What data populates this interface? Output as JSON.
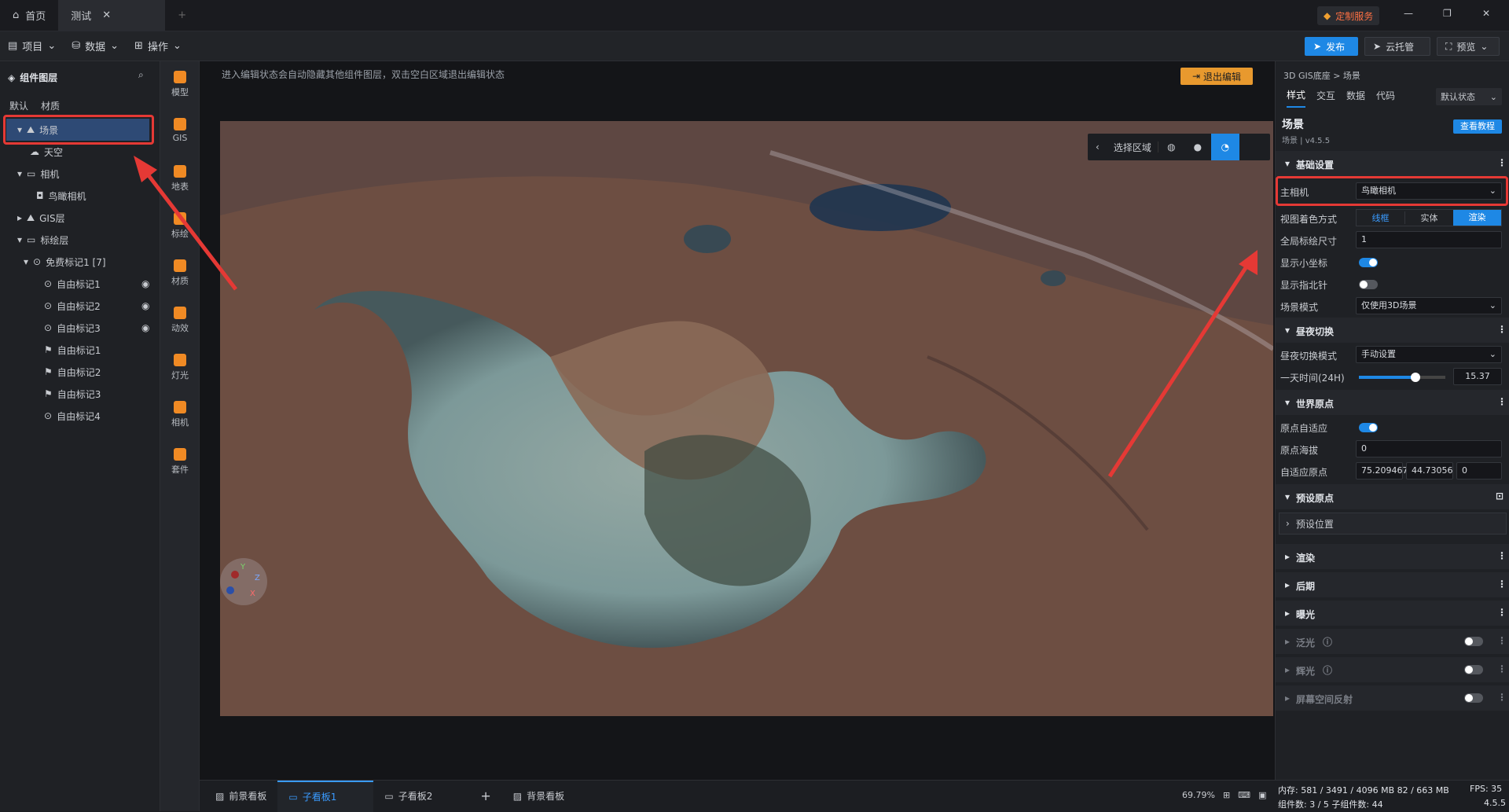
{
  "titlebar": {
    "home_tab": "首页",
    "test_tab": "测试",
    "custom_service": "定制服务"
  },
  "toolbar": {
    "project": "项目",
    "data": "数据",
    "operate": "操作",
    "publish": "发布",
    "cloud_host": "云托管",
    "preview": "预览"
  },
  "leftpanel": {
    "title": "组件图层",
    "tabs": [
      "默认",
      "材质"
    ],
    "tree": [
      {
        "label": "场景"
      },
      {
        "label": "天空"
      },
      {
        "label": "相机"
      },
      {
        "label": "鸟瞰相机"
      },
      {
        "label": "GIS层"
      },
      {
        "label": "标绘层"
      },
      {
        "label": "免费标记1 [7]"
      },
      {
        "label": "自由标记1"
      },
      {
        "label": "自由标记2"
      },
      {
        "label": "自由标记3"
      },
      {
        "label": "自由标记1"
      },
      {
        "label": "自由标记2"
      },
      {
        "label": "自由标记3"
      },
      {
        "label": "自由标记4"
      }
    ]
  },
  "iconbar": [
    {
      "label": "模型"
    },
    {
      "label": "GIS"
    },
    {
      "label": "地表"
    },
    {
      "label": "标绘"
    },
    {
      "label": "材质"
    },
    {
      "label": "动效"
    },
    {
      "label": "灯光"
    },
    {
      "label": "相机"
    },
    {
      "label": "套件"
    }
  ],
  "canvas": {
    "hint": "进入编辑状态会自动隐藏其他组件图层，双击空白区域退出编辑状态",
    "exit_edit": "退出编辑",
    "select_region": "选择区域",
    "axis_x": "X",
    "axis_y": "Y",
    "axis_z": "Z"
  },
  "rightpanel": {
    "breadcrumb": "3D GIS底座 > 场景",
    "tabs": [
      "样式",
      "交互",
      "数据",
      "代码"
    ],
    "state_select": "默认状态",
    "comp_title": "场景",
    "comp_sub": "场景 | v4.5.5",
    "tutorial": "查看教程",
    "sections": {
      "basic": "基础设置",
      "daynight": "昼夜切换",
      "origin": "世界原点",
      "preset_origin": "预设原点",
      "render": "渲染",
      "post": "后期",
      "exposure": "曝光",
      "bloom": "泛光",
      "glow": "辉光",
      "ssr": "屏幕空间反射"
    },
    "main_camera_label": "主相机",
    "main_camera_value": "鸟瞰相机",
    "shading_label": "视图着色方式",
    "shading_options": [
      "线框",
      "实体",
      "渲染"
    ],
    "marker_size_label": "全局标绘尺寸",
    "marker_size_value": "1",
    "show_axes_label": "显示小坐标",
    "show_compass_label": "显示指北针",
    "scene_mode_label": "场景模式",
    "scene_mode_value": "仅使用3D场景",
    "daynight_mode_label": "昼夜切换模式",
    "daynight_mode_value": "手动设置",
    "day_time_label": "一天时间(24H)",
    "day_time_value": "15.37",
    "origin_auto_label": "原点自适应",
    "origin_alt_label": "原点海拔",
    "origin_alt_value": "0",
    "auto_origin_label": "自适应原点",
    "auto_origin_values": [
      "75.209467",
      "44.730563",
      "0"
    ],
    "preset_position": "预设位置"
  },
  "bottombar": {
    "tabs": [
      "前景看板",
      "子看板1",
      "子看板2",
      "背景看板"
    ],
    "add": "+",
    "zoom": "69.79%"
  },
  "status": {
    "memory": "内存: 581 / 3491 / 4096 MB  82 / 663 MB",
    "fps": "FPS: 35",
    "components": "组件数: 3 / 5    子组件数: 44",
    "version": "4.5.5"
  },
  "colors": {
    "accent": "#1e88e5",
    "highlight": "#e53935",
    "exit": "#e8992e"
  }
}
